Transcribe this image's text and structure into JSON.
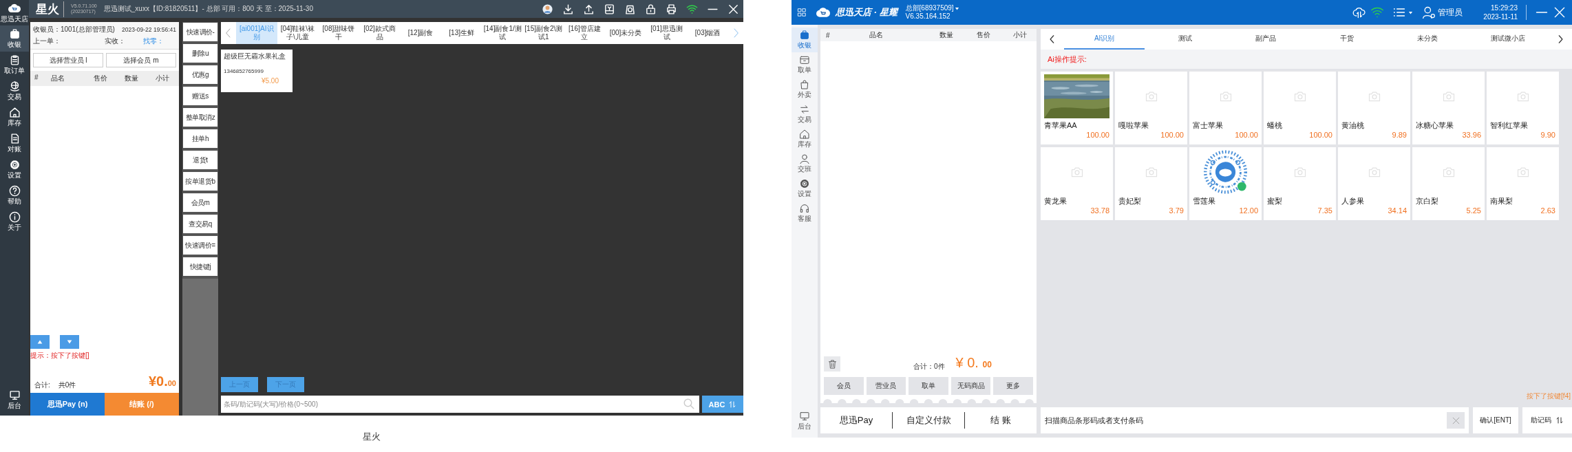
{
  "left_app": {
    "title_bar": {
      "app_name": "星火",
      "version": "V5.0.71.100",
      "build": "(20230717)",
      "info": "思迅测试_xuxx【ID:81820511】- 总部 可用：800 天 至：2025-11-30"
    },
    "sidebar": {
      "logo_label": "思迅天店",
      "items": [
        {
          "label": "收银",
          "selected": true
        },
        {
          "label": "取订单",
          "selected": false
        },
        {
          "label": "交易",
          "selected": false
        },
        {
          "label": "库存",
          "selected": false
        },
        {
          "label": "对账",
          "selected": false
        },
        {
          "label": "设置",
          "selected": false
        },
        {
          "label": "帮助",
          "selected": false
        },
        {
          "label": "关于",
          "selected": false
        }
      ],
      "footer": "后台"
    },
    "cart": {
      "cashier": "收银员：1001(总部管理员)",
      "time": "2023-09-22 19:56:41",
      "previous_order": "上一单：",
      "received": "实收：",
      "change": "找零：",
      "buttons": [
        "选择营业员 l",
        "选择会员 m"
      ],
      "columns": [
        "#",
        "品名",
        "售价",
        "数量",
        "小计"
      ],
      "hint": "提示：按下了按键[]",
      "total_label": "合计:",
      "count": "共0件",
      "amount_main": "¥0.",
      "amount_cents": "00",
      "pay_buttons": [
        {
          "label": "思迅Pay (n)",
          "kind": "pay"
        },
        {
          "label": "结账 (/)",
          "kind": "checkout"
        }
      ]
    },
    "function_buttons": [
      "快速调价-",
      "删除u",
      "优惠g",
      "赠送s",
      "整单取消z",
      "挂单h",
      "退货t",
      "按单退货b",
      "会员m",
      "查交易q",
      "快速调价=",
      "快捷键j"
    ],
    "categories": [
      {
        "label": "[ai001]AI识别",
        "selected": true
      },
      {
        "label": "[04]鞋袜\\袜子\\儿童",
        "selected": false
      },
      {
        "label": "[08]甜味饼干",
        "selected": false
      },
      {
        "label": "[02]款式商品",
        "selected": false
      },
      {
        "label": "[12]副食",
        "selected": false
      },
      {
        "label": "[13]生鲜",
        "selected": false
      },
      {
        "label": "[14]副食1/测试",
        "selected": false
      },
      {
        "label": "[15]副食2\\测试1",
        "selected": false
      },
      {
        "label": "[16]管店建立",
        "selected": false
      },
      {
        "label": "[00]未分类",
        "selected": false
      },
      {
        "label": "[01]思迅测试",
        "selected": false
      },
      {
        "label": "[03]烟酒",
        "selected": false
      }
    ],
    "products": [
      {
        "name": "超级巨无霸水果礼盒",
        "barcode": "1346852765999",
        "price": "¥5.00"
      }
    ],
    "pager": [
      "上一页",
      "下一页"
    ],
    "search": {
      "placeholder": "条码/助记码(大写)/价格(0~500)"
    },
    "keyboard_button": "ABC"
  },
  "left_caption": "星火",
  "right_app": {
    "title_bar": {
      "brand": "思迅天店 · 星耀",
      "store": "总部[68937509]",
      "version": "V6.35.164.152",
      "user": "管理员",
      "time": "15:29:23",
      "date": "2023-11-11"
    },
    "sidebar": {
      "items": [
        {
          "label": "收银",
          "selected": true
        },
        {
          "label": "取单",
          "selected": false
        },
        {
          "label": "外卖",
          "selected": false
        },
        {
          "label": "交易",
          "selected": false
        },
        {
          "label": "库存",
          "selected": false
        },
        {
          "label": "交班",
          "selected": false
        },
        {
          "label": "设置",
          "selected": false
        },
        {
          "label": "客服",
          "selected": false
        }
      ],
      "footer": "后台"
    },
    "cart": {
      "columns": [
        "#",
        "品名",
        "数量",
        "售价",
        "小计"
      ],
      "total": "合计：0件",
      "amount_main": "¥ 0.",
      "amount_cents": "00",
      "actions": [
        "会员",
        "营业员",
        "取单",
        "无码商品",
        "更多"
      ]
    },
    "categories": [
      {
        "label": "AI识别",
        "selected": true
      },
      {
        "label": "测试",
        "selected": false
      },
      {
        "label": "副产品",
        "selected": false
      },
      {
        "label": "干货",
        "selected": false
      },
      {
        "label": "未分类",
        "selected": false
      },
      {
        "label": "测试微小店",
        "selected": false
      }
    ],
    "ai_hint": "Ai操作提示:",
    "products": [
      {
        "name": "青苹果AA",
        "price": "100.00",
        "kind": "picture"
      },
      {
        "name": "嘎啦苹果",
        "price": "100.00",
        "kind": "none"
      },
      {
        "name": "富士苹果",
        "price": "100.00",
        "kind": "none"
      },
      {
        "name": "蟠桃",
        "price": "100.00",
        "kind": "none"
      },
      {
        "name": "黄油桃",
        "price": "9.89",
        "kind": "none"
      },
      {
        "name": "冰糖心苹果",
        "price": "33.96",
        "kind": "none"
      },
      {
        "name": "智利红苹果",
        "price": "9.90",
        "kind": "none"
      },
      {
        "name": "黄龙果",
        "price": "33.78",
        "kind": "none"
      },
      {
        "name": "贵妃梨",
        "price": "3.79",
        "kind": "none"
      },
      {
        "name": "雪莲果",
        "price": "12.00",
        "kind": "code"
      },
      {
        "name": "蜜梨",
        "price": "7.35",
        "kind": "none"
      },
      {
        "name": "人参果",
        "price": "34.14",
        "kind": "none"
      },
      {
        "name": "京白梨",
        "price": "5.25",
        "kind": "none"
      },
      {
        "name": "南果梨",
        "price": "2.63",
        "kind": "none"
      }
    ],
    "key_hint": "按下了按键[f4]",
    "pay_buttons": [
      "思迅Pay",
      "自定义付款",
      "结 账"
    ],
    "scan": {
      "placeholder": "扫描商品条形码或者支付条码"
    },
    "confirm_button": "确认[ENT]",
    "mnemonic_button": "助记码"
  }
}
